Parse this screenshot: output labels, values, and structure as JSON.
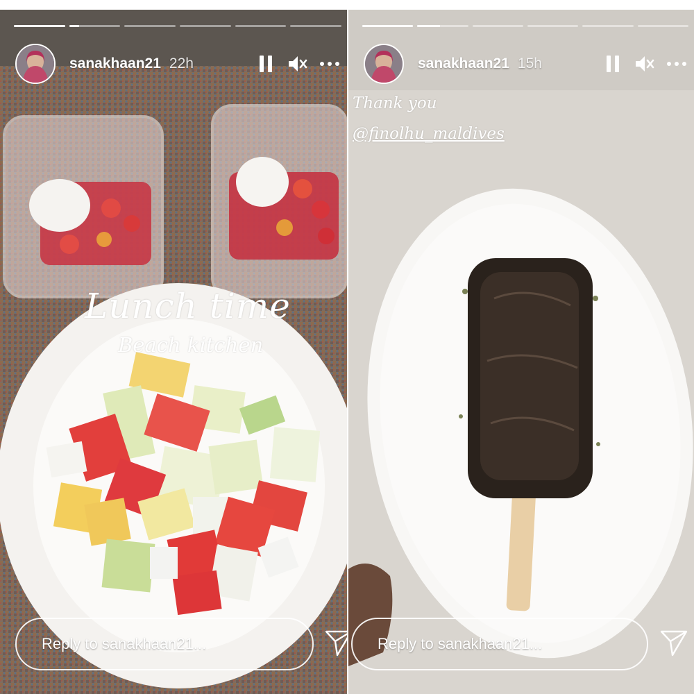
{
  "stories": [
    {
      "username": "sanakhaan21",
      "time_ago": "22h",
      "progress": [
        1,
        0.2,
        0,
        0,
        0,
        0
      ],
      "captions": {
        "line1": "Lunch time",
        "line2": "Beach kitchen"
      },
      "reply_placeholder": "Reply to sanakhaan21..."
    },
    {
      "username": "sanakhaan21",
      "time_ago": "15h",
      "progress": [
        1,
        0.45,
        0,
        0,
        0,
        0
      ],
      "captions": {
        "line1": "Thank you",
        "mention": "@finolhu_maldives"
      },
      "reply_placeholder": "Reply to sanakhaan21..."
    }
  ],
  "icons": {
    "pause": "pause-icon",
    "mute": "mute-icon",
    "more": "more-icon",
    "send": "send-icon"
  },
  "colors": {
    "bar_fill": "#ffffff",
    "bar_empty": "rgba(255,255,255,0.45)"
  }
}
